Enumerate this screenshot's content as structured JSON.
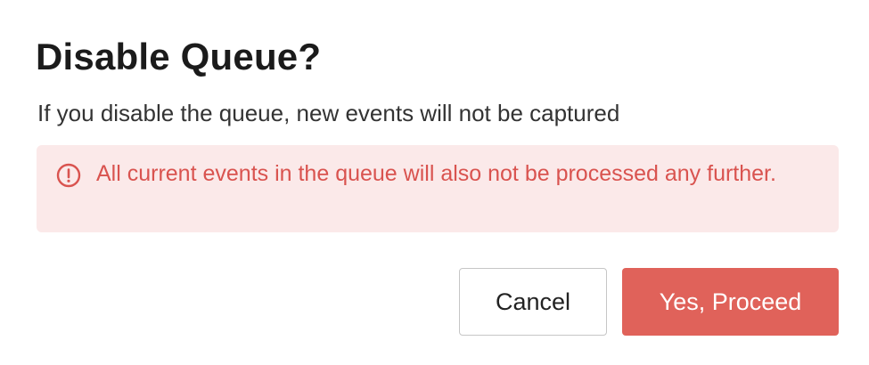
{
  "dialog": {
    "title": "Disable Queue?",
    "description": "If you disable the queue, new events will not be captured",
    "warning": {
      "icon": "exclamation-circle-icon",
      "text": "All current events in the queue will also not be processed any further."
    },
    "buttons": {
      "cancel_label": "Cancel",
      "proceed_label": "Yes, Proceed"
    },
    "colors": {
      "danger": "#e0625a",
      "warning_text": "#d9534f",
      "warning_background": "#fbe9e9"
    }
  }
}
